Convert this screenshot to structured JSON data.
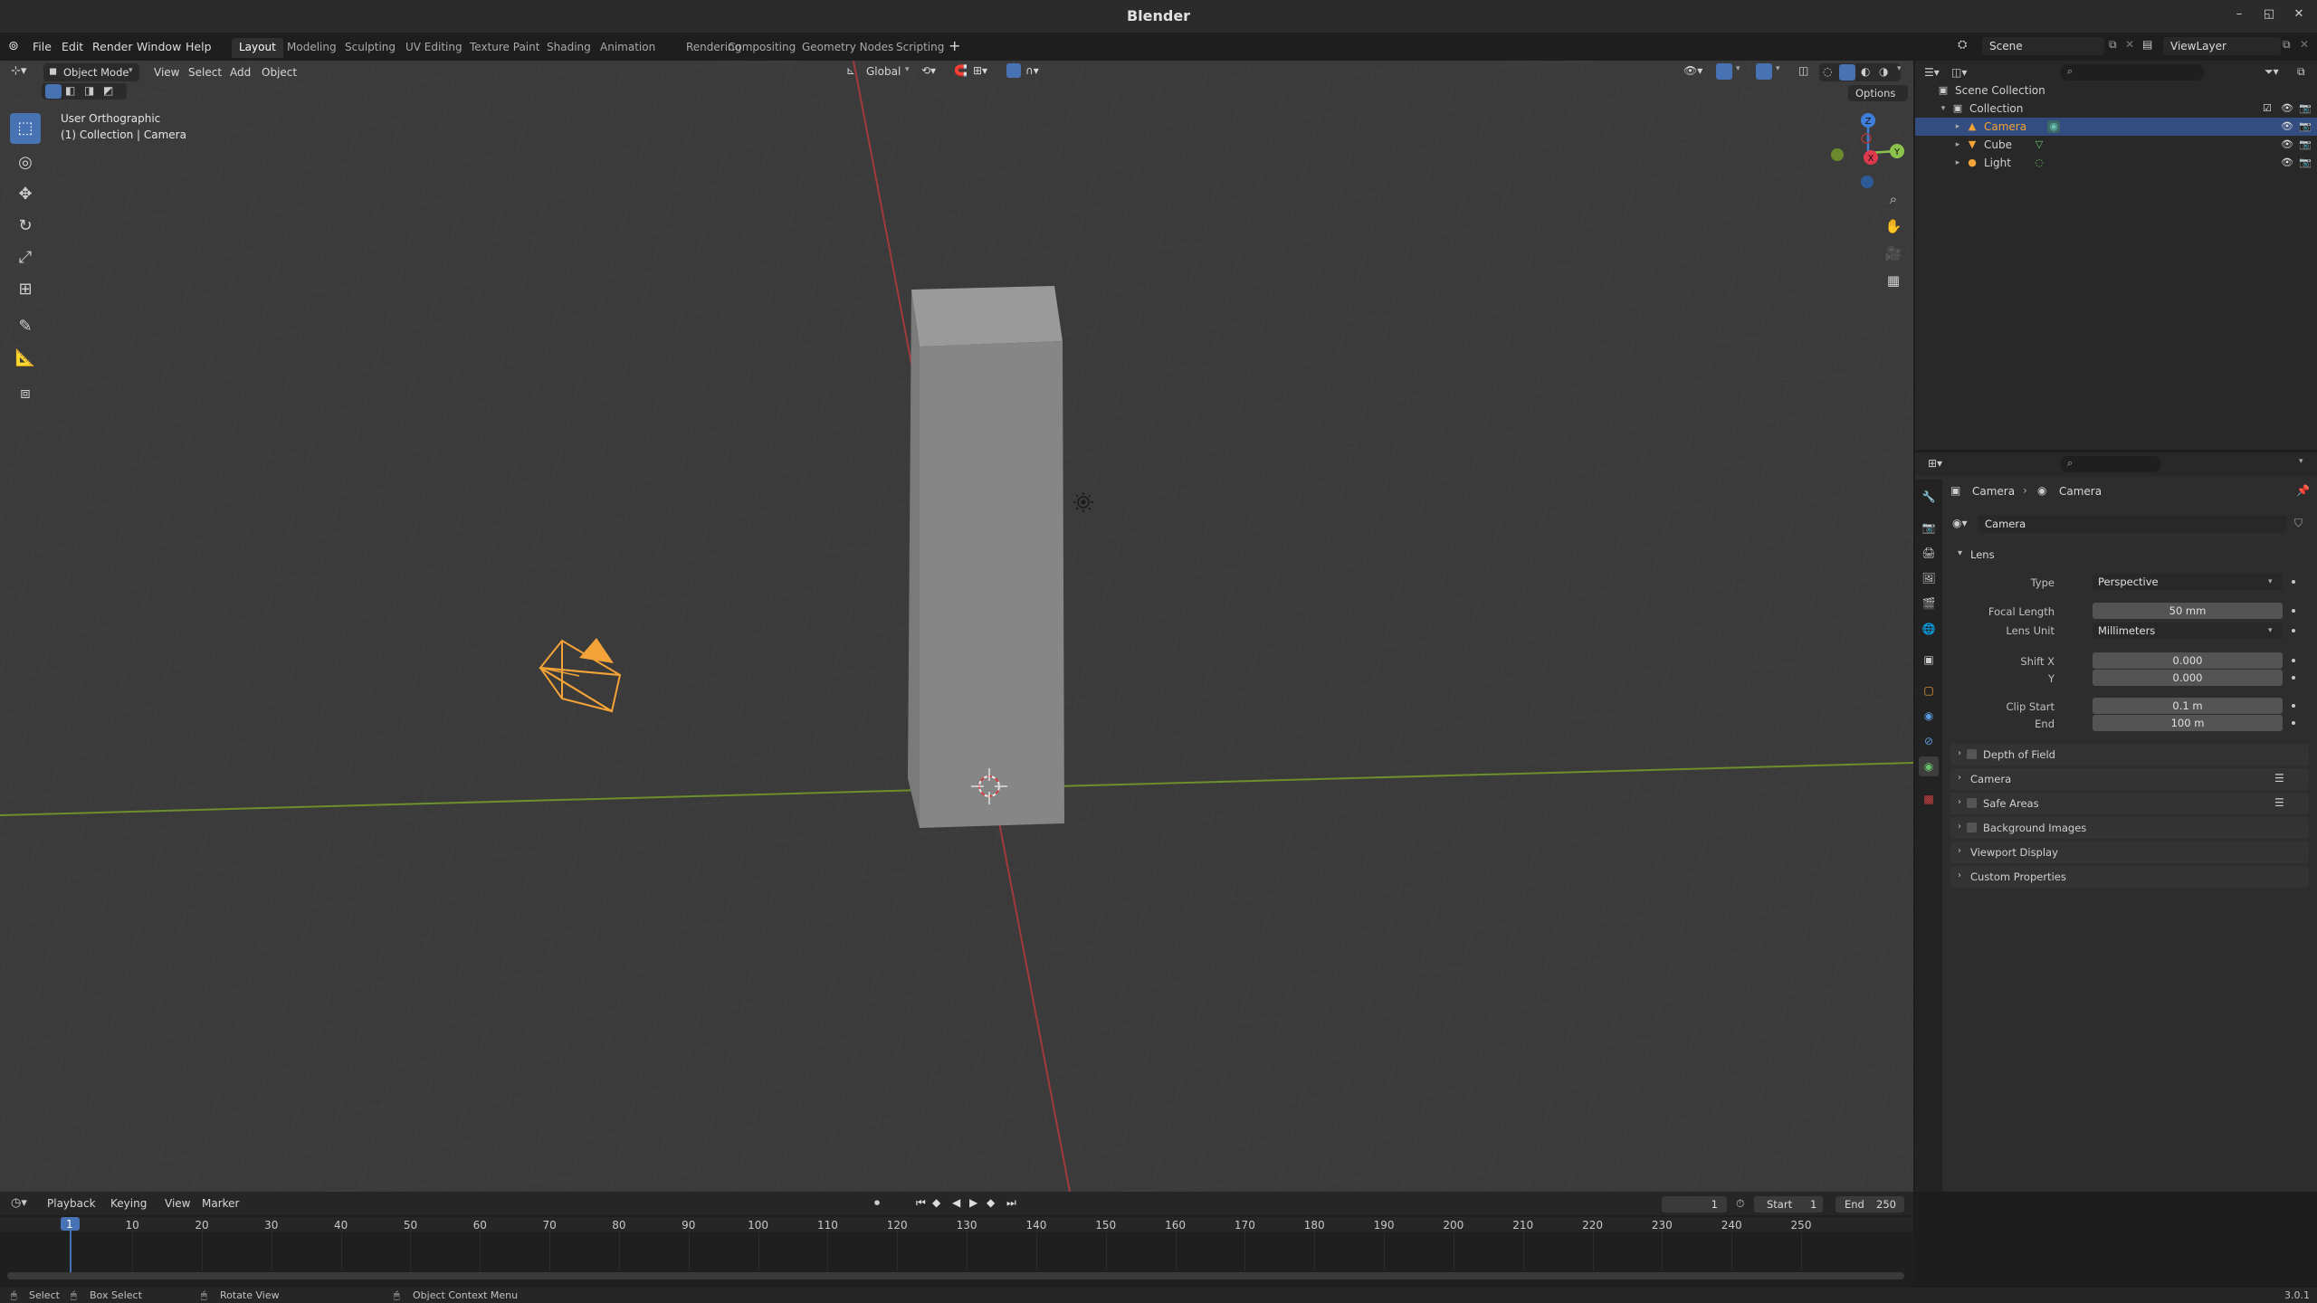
{
  "window": {
    "title": "Blender"
  },
  "menu": {
    "items": [
      "File",
      "Edit",
      "Render",
      "Window",
      "Help"
    ]
  },
  "workspaces": [
    "Layout",
    "Modeling",
    "Sculpting",
    "UV Editing",
    "Texture Paint",
    "Shading",
    "Animation",
    "Rendering",
    "Compositing",
    "Geometry Nodes",
    "Scripting"
  ],
  "workspace_active": "Layout",
  "scene": {
    "name": "Scene",
    "view_layer": "ViewLayer"
  },
  "viewport": {
    "mode": "Object Mode",
    "menus": [
      "View",
      "Select",
      "Add",
      "Object"
    ],
    "transform_orientation": "Global",
    "options_label": "Options",
    "view_name": "User Orthographic",
    "context_line": "(1) Collection | Camera"
  },
  "outliner": {
    "root": "Scene Collection",
    "collection": "Collection",
    "objects": [
      {
        "name": "Camera",
        "selected": true
      },
      {
        "name": "Cube",
        "selected": false
      },
      {
        "name": "Light",
        "selected": false
      }
    ]
  },
  "properties": {
    "breadcrumb": [
      "Camera",
      "Camera"
    ],
    "datablock": "Camera",
    "lens_panel": "Lens",
    "type_label": "Type",
    "type_value": "Perspective",
    "focal_length_label": "Focal Length",
    "focal_length_value": "50 mm",
    "lens_unit_label": "Lens Unit",
    "lens_unit_value": "Millimeters",
    "shift_x_label": "Shift X",
    "shift_x_value": "0.000",
    "shift_y_label": "Y",
    "shift_y_value": "0.000",
    "clip_start_label": "Clip Start",
    "clip_start_value": "0.1 m",
    "clip_end_label": "End",
    "clip_end_value": "100 m",
    "panels": [
      "Depth of Field",
      "Camera",
      "Safe Areas",
      "Background Images",
      "Viewport Display",
      "Custom Properties"
    ]
  },
  "timeline": {
    "menus": [
      "Playback",
      "Keying",
      "View",
      "Marker"
    ],
    "current_frame": "1",
    "start_label": "Start",
    "start_value": "1",
    "end_label": "End",
    "end_value": "250",
    "ticks": [
      "1",
      "10",
      "20",
      "30",
      "40",
      "50",
      "60",
      "70",
      "80",
      "90",
      "100",
      "110",
      "120",
      "130",
      "140",
      "150",
      "160",
      "170",
      "180",
      "190",
      "200",
      "210",
      "220",
      "230",
      "240",
      "250"
    ]
  },
  "statusbar": {
    "select": "Select",
    "box_select": "Box Select",
    "rotate_view": "Rotate View",
    "context_menu": "Object Context Menu",
    "version": "3.0.1"
  },
  "gizmo": {
    "x": "X",
    "y": "Y",
    "z": "Z"
  },
  "colors": {
    "accent": "#4772b3",
    "x_axis": "#e03a4e",
    "y_axis": "#8bc34a",
    "z_axis": "#3d7fd9",
    "camera_orange": "#f3a338",
    "selection_bg": "#334d80"
  }
}
